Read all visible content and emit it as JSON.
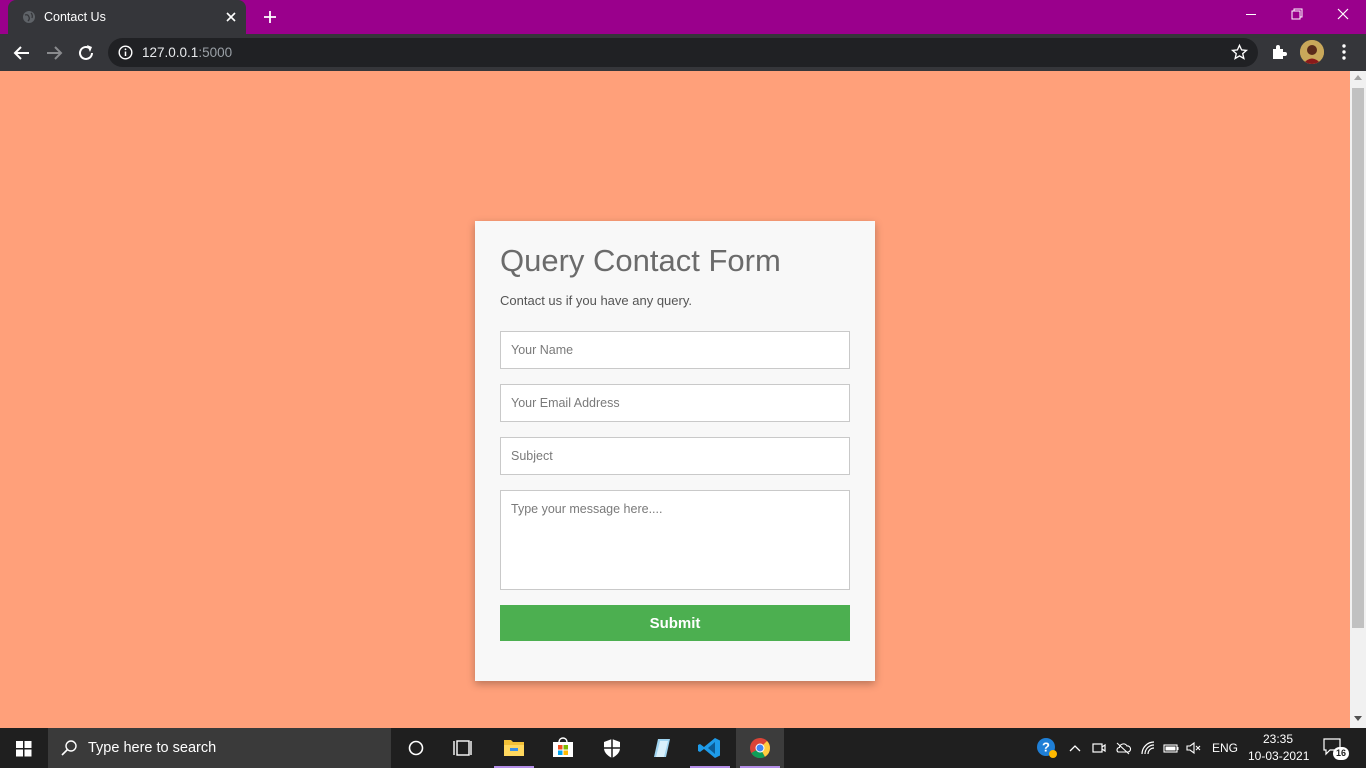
{
  "browser": {
    "tab_title": "Contact Us",
    "url_host": "127.0.0.1",
    "url_port": ":5000",
    "accent_color": "#9a008c"
  },
  "form": {
    "title": "Query Contact Form",
    "subtitle": "Contact us if you have any query.",
    "name_placeholder": "Your Name",
    "email_placeholder": "Your Email Address",
    "subject_placeholder": "Subject",
    "message_placeholder": "Type your message here....",
    "submit_label": "Submit",
    "page_background": "#ffa07a",
    "submit_color": "#4caf50"
  },
  "taskbar": {
    "search_placeholder": "Type here to search",
    "language": "ENG",
    "time": "23:35",
    "date": "10-03-2021",
    "notification_count": "16",
    "icons": [
      "windows-start-icon",
      "cortana-icon",
      "task-view-icon",
      "file-explorer-icon",
      "microsoft-store-icon",
      "security-shield-icon",
      "notepad-icon",
      "vscode-icon",
      "chrome-icon"
    ]
  }
}
